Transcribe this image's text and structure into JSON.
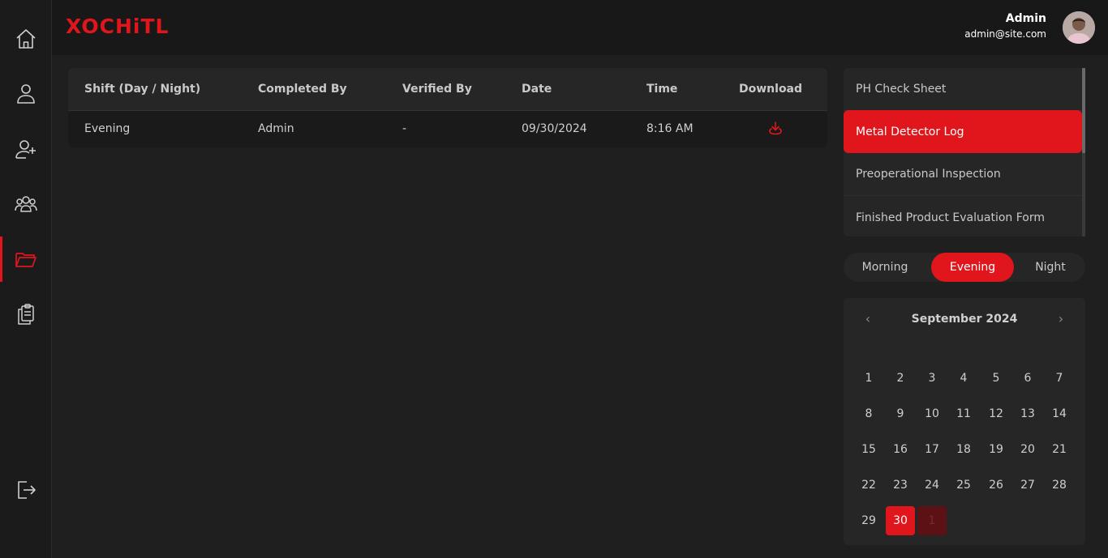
{
  "brand": {
    "logo": "XOCHiTL",
    "accent": "#e0161c"
  },
  "user": {
    "name": "Admin",
    "email": "admin@site.com"
  },
  "sidebar": {
    "items": [
      {
        "icon": "home-icon"
      },
      {
        "icon": "user-icon"
      },
      {
        "icon": "user-add-icon"
      },
      {
        "icon": "group-icon"
      },
      {
        "icon": "folder-icon",
        "active": true
      },
      {
        "icon": "clipboard-copy-icon"
      }
    ],
    "logout_icon": "logout-icon"
  },
  "table": {
    "headers": [
      "Shift (Day / Night)",
      "Completed By",
      "Verified By",
      "Date",
      "Time",
      "Download"
    ],
    "rows": [
      [
        "Evening",
        "Admin",
        "-",
        "09/30/2024",
        "8:16 AM",
        "download-icon"
      ]
    ]
  },
  "forms": [
    {
      "label": "PH Check Sheet"
    },
    {
      "label": "Metal Detector Log",
      "active": true
    },
    {
      "label": "Preoperational Inspection"
    },
    {
      "label": "Finished Product Evaluation Form"
    }
  ],
  "shifts": [
    {
      "label": "Morning"
    },
    {
      "label": "Evening",
      "active": true
    },
    {
      "label": "Night"
    }
  ],
  "calendar": {
    "title": "September 2024",
    "prev": "‹",
    "next": "›",
    "days": [
      "1",
      "2",
      "3",
      "4",
      "5",
      "6",
      "7",
      "8",
      "9",
      "10",
      "11",
      "12",
      "13",
      "14",
      "15",
      "16",
      "17",
      "18",
      "19",
      "20",
      "21",
      "22",
      "23",
      "24",
      "25",
      "26",
      "27",
      "28",
      "29",
      "30"
    ],
    "selected_day": "30",
    "next_month_day": "1"
  }
}
